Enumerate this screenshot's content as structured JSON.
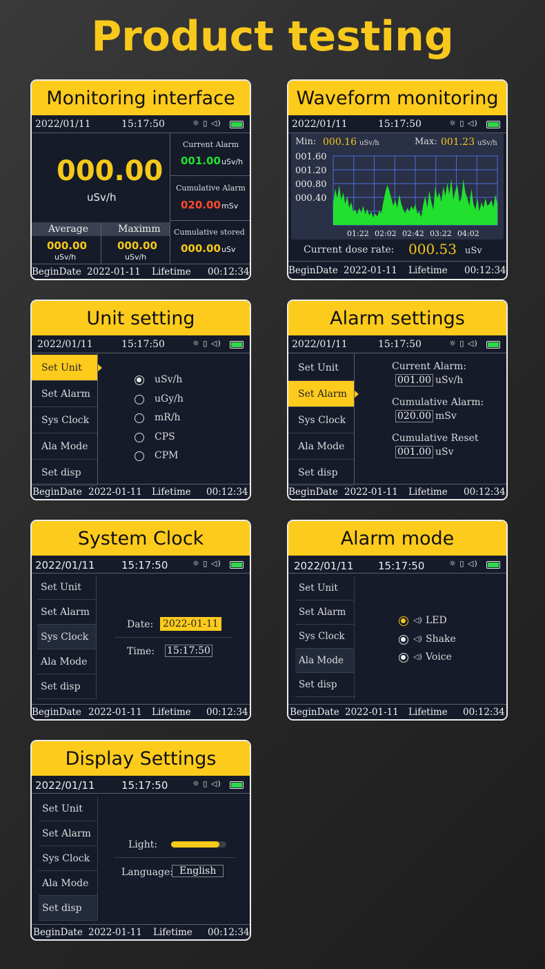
{
  "page_title": "Product testing",
  "status": {
    "date": "2022/01/11",
    "time": "15:17:50",
    "icons": "☼ ▯ ◁)"
  },
  "footer": {
    "begin_label": "BeginDate",
    "begin_date": "2022-01-11",
    "life_label": "Lifetime",
    "life_value": "00:12:34"
  },
  "menu": [
    "Set Unit",
    "Set Alarm",
    "Sys Clock",
    "Ala Mode",
    "Set disp"
  ],
  "monitoring": {
    "title": "Monitoring interface",
    "main_value": "000.00",
    "main_unit": "uSv/h",
    "current_alarm_label": "Current Alarm",
    "current_alarm_value": "001.00",
    "current_alarm_unit": "uSv/h",
    "cum_alarm_label": "Cumulative Alarm",
    "cum_alarm_value": "020.00",
    "cum_alarm_unit": "mSv",
    "cum_stored_label": "Cumulative stored",
    "cum_stored_value": "000.00",
    "cum_stored_unit": "uSv",
    "average_label": "Average",
    "average_value": "000.00",
    "average_unit": "uSv/h",
    "max_label": "Maximm",
    "max_value": "000.00",
    "max_unit": "uSv/h",
    "colors": {
      "accent": "#f4c919",
      "green": "#22e02e",
      "red": "#ff4a2a"
    }
  },
  "waveform": {
    "title": "Waveform monitoring",
    "min_label": "Min:",
    "min_value": "000.16",
    "min_unit": "uSv/h",
    "max_label": "Max:",
    "max_value": "001.23",
    "max_unit": "uSv/h",
    "dose_label": "Current dose rate:",
    "dose_value": "000.53",
    "dose_unit": "uSv",
    "chart_data": {
      "type": "area",
      "y_tick_labels": [
        "001.60",
        "001.20",
        "000.80",
        "000.40"
      ],
      "x_tick_labels": [
        "01:22",
        "02:02",
        "02:42",
        "03:22",
        "04:02"
      ],
      "ylim": [
        0,
        1.8
      ],
      "grid": true,
      "values": [
        0.55,
        0.95,
        0.7,
        1.05,
        0.65,
        0.85,
        0.55,
        0.75,
        0.45,
        0.6,
        0.35,
        0.4,
        0.28,
        0.45,
        0.32,
        0.5,
        0.28,
        0.42,
        0.25,
        0.35,
        0.2,
        0.3,
        0.22,
        0.38,
        0.3,
        0.6,
        0.85,
        1.05,
        0.9,
        0.7,
        0.5,
        0.65,
        0.45,
        0.8,
        0.55,
        0.4,
        0.3,
        0.45,
        0.35,
        0.5,
        0.4,
        0.55,
        0.3,
        0.35,
        0.2,
        0.55,
        0.75,
        0.45,
        0.9,
        0.6,
        0.4,
        1.0,
        0.7,
        0.85,
        0.6,
        1.0,
        0.75,
        1.1,
        0.8,
        1.2,
        0.65,
        0.9,
        1.05,
        0.6,
        0.7,
        1.2,
        0.85,
        0.7,
        0.5,
        0.95,
        0.55,
        0.4,
        0.7,
        0.35,
        0.6,
        0.45,
        0.7,
        0.5,
        0.55,
        0.65,
        0.45,
        0.8,
        0.55
      ],
      "colors": {
        "fill": "#22e02e",
        "grid": "#4a6ee0",
        "bg": "#2a3045"
      }
    }
  },
  "unit_setting": {
    "title": "Unit setting",
    "options": [
      "uSv/h",
      "uGy/h",
      "mR/h",
      "CPS",
      "CPM"
    ],
    "selected": 0
  },
  "alarm_settings": {
    "title": "Alarm settings",
    "current_label": "Current Alarm:",
    "current_value": "001.00",
    "current_unit": "uSv/h",
    "cum_label": "Cumulative Alarm:",
    "cum_value": "020.00",
    "cum_unit": "mSv",
    "reset_label": "Cumulative Reset",
    "reset_value": "001.00",
    "reset_unit": "uSv"
  },
  "system_clock": {
    "title": "System Clock",
    "date_label": "Date:",
    "date_value": "2022-01-11",
    "time_label": "Time:",
    "time_value": "15:17:50"
  },
  "alarm_mode": {
    "title": "Alarm mode",
    "options": [
      "LED",
      "Shake",
      "Voice"
    ],
    "selected": 0
  },
  "display_settings": {
    "title": "Display Settings",
    "light_label": "Light:",
    "light_level": 0.88,
    "language_label": "Language:",
    "language_value": "English"
  }
}
